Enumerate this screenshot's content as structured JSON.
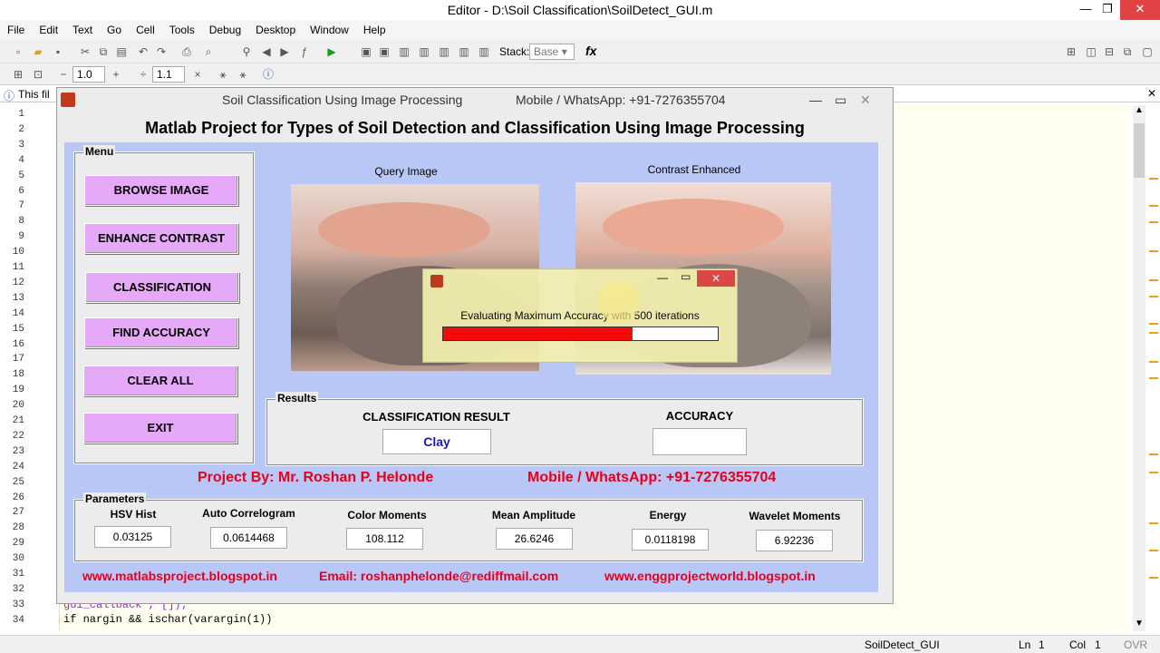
{
  "editor": {
    "title": "Editor - D:\\Soil Classification\\SoilDetect_GUI.m",
    "menu": [
      "File",
      "Edit",
      "Text",
      "Go",
      "Cell",
      "Tools",
      "Debug",
      "Desktop",
      "Window",
      "Help"
    ],
    "stack_label": "Stack:",
    "stack_value": "Base",
    "fx_label": "fx",
    "cell_val1": "1.0",
    "cell_val2": "1.1",
    "info_text": "This fil",
    "line_numbers": [
      "1",
      "2",
      "3",
      "4",
      "5",
      "6",
      "7",
      "8",
      "9",
      "10",
      "11",
      "12",
      "13",
      "14",
      "15",
      "16",
      "17",
      "18",
      "19",
      "20",
      "21",
      "22",
      "23",
      "24",
      "25",
      "26",
      "27",
      "28",
      "29",
      "30",
      "31",
      "32",
      "33",
      "34"
    ],
    "code_line_34": "if nargin && ischar(varargin(1))",
    "code_line_33": "gui_callback', []);",
    "status_file": "SoilDetect_GUI",
    "status_ln_label": "Ln",
    "status_ln": "1",
    "status_col_label": "Col",
    "status_col": "1",
    "status_ovr": "OVR"
  },
  "figure": {
    "title_left": "Soil Classification Using Image Processing",
    "title_right": "Mobile / WhatsApp: +91-7276355704",
    "headline": "Matlab Project for Types of Soil Detection and Classification Using Image Processing",
    "menu_panel_title": "Menu",
    "buttons": [
      "BROWSE IMAGE",
      "ENHANCE CONTRAST",
      "CLASSIFICATION",
      "FIND ACCURACY",
      "CLEAR ALL",
      "EXIT"
    ],
    "query_caption": "Query Image",
    "enhanced_caption": "Contrast Enhanced",
    "results_panel_title": "Results",
    "classification_label": "CLASSIFICATION RESULT",
    "classification_value": "Clay",
    "accuracy_label": "ACCURACY",
    "accuracy_value": "",
    "project_by": "Project By: Mr. Roshan P. Helonde",
    "mobile": "Mobile / WhatsApp: +91-7276355704",
    "params_title": "Parameters",
    "params": [
      {
        "label": "HSV Hist",
        "value": "0.03125"
      },
      {
        "label": "Auto Correlogram",
        "value": "0.0614468"
      },
      {
        "label": "Color Moments",
        "value": "108.112"
      },
      {
        "label": "Mean Amplitude",
        "value": "26.6246"
      },
      {
        "label": "Energy",
        "value": "0.0118198"
      },
      {
        "label": "Wavelet Moments",
        "value": "6.92236"
      }
    ],
    "footer_site1": "www.matlabsproject.blogspot.in",
    "footer_email": "Email: roshanphelonde@rediffmail.com",
    "footer_site2": "www.enggprojectworld.blogspot.in"
  },
  "dialog": {
    "message": "Evaluating Maximum Accuracy with 500 iterations",
    "progress": 0.69
  },
  "colors": {
    "accent_red": "#e8001a",
    "button": "#e5a9f7",
    "panel_bg": "#b9c7f7",
    "result_blue": "#1a1ab0"
  }
}
